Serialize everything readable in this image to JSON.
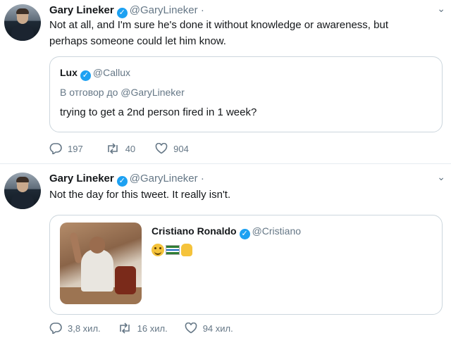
{
  "tweets": [
    {
      "author": {
        "name": "Gary Lineker",
        "handle": "@GaryLineker",
        "dot": "·"
      },
      "text_line1": "Not at all, and I'm sure he's done it  without knowledge or awareness, but",
      "text_line2": "perhaps someone could let him know.",
      "quote": {
        "name": "Lux",
        "handle": "@Callux",
        "reply_to": "В отговор до @GaryLineker",
        "text": "trying to get a 2nd person fired in 1 week?"
      },
      "actions": {
        "replies": "197",
        "retweets": "40",
        "likes": "904"
      }
    },
    {
      "author": {
        "name": "Gary Lineker",
        "handle": "@GaryLineker",
        "dot": "·"
      },
      "text_line1": "Not the day for this tweet. It really isn't.",
      "quote": {
        "name": "Cristiano Ronaldo",
        "handle": "@Cristiano",
        "emojis": [
          "smile-emoji",
          "flag-emoji",
          "thumbs-up-emoji"
        ]
      },
      "actions": {
        "replies": "3,8 хил.",
        "retweets": "16 хил.",
        "likes": "94 хил."
      }
    }
  ],
  "icons": {
    "verified": "✓",
    "chevron": "⌄"
  },
  "colors": {
    "accent": "#1da1f2",
    "muted": "#657786",
    "border": "#ccd6dd"
  }
}
